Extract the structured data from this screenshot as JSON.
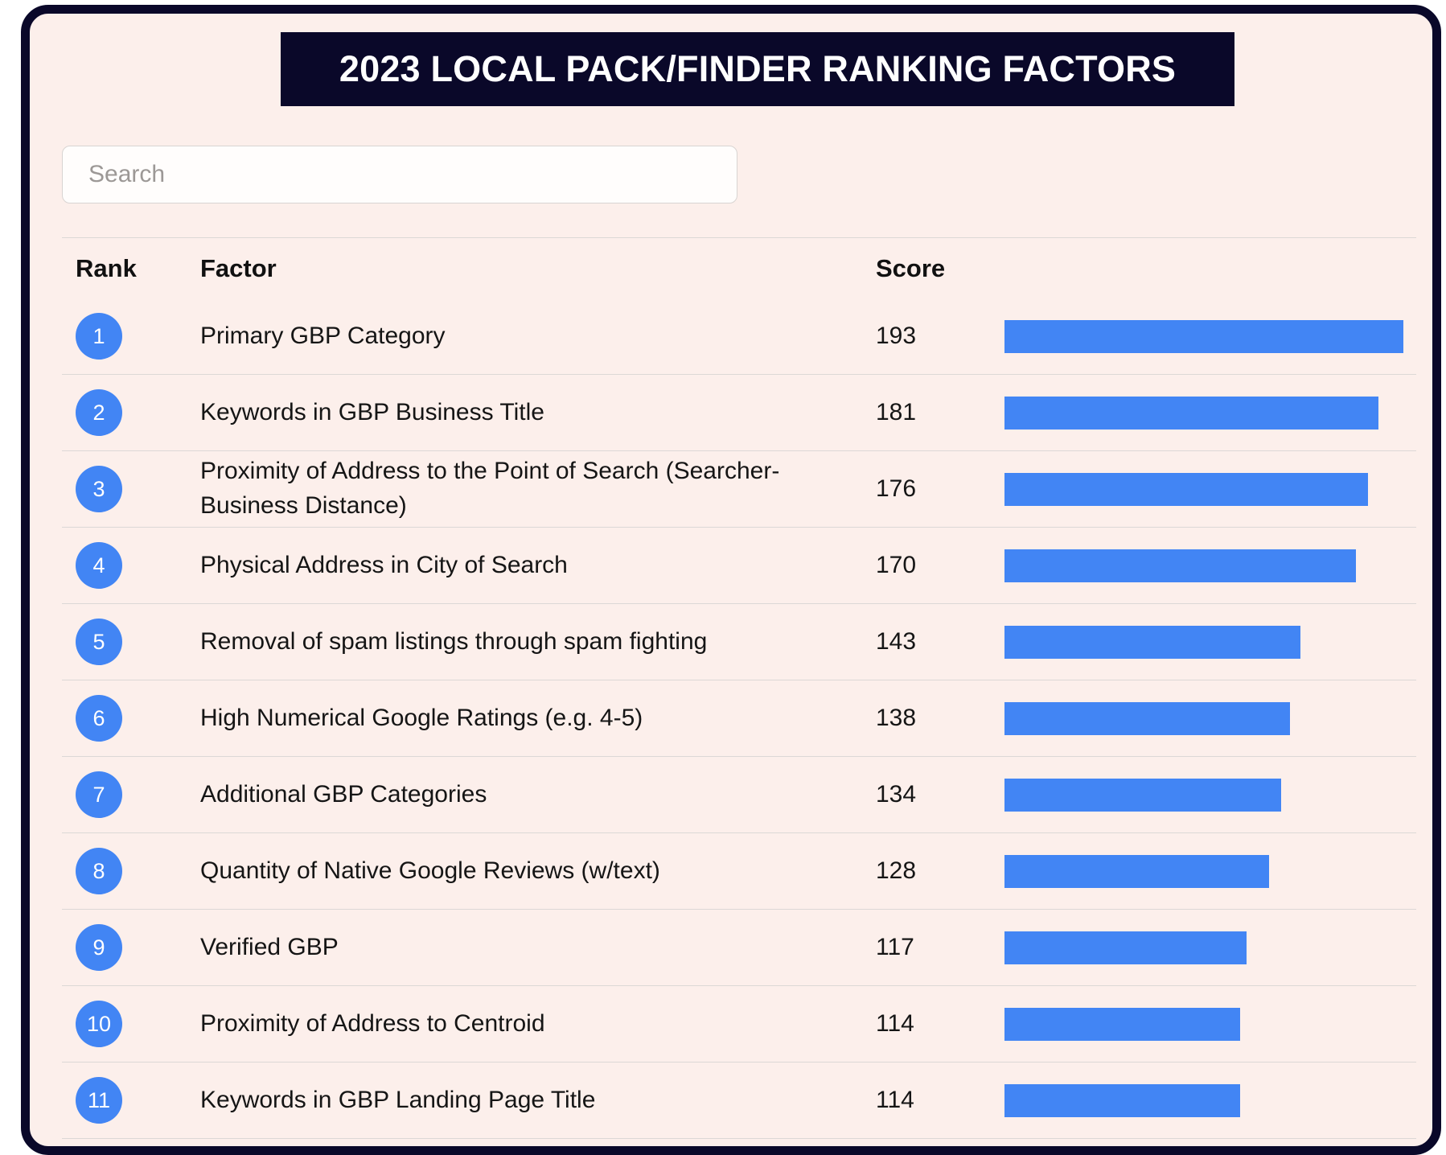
{
  "header": {
    "title": "2023 LOCAL PACK/FINDER RANKING FACTORS"
  },
  "search": {
    "placeholder": "Search",
    "value": ""
  },
  "table": {
    "columns": [
      "Rank",
      "Factor",
      "Score"
    ],
    "rows": [
      {
        "rank": "1",
        "factor": "Primary GBP Category",
        "score": "193"
      },
      {
        "rank": "2",
        "factor": "Keywords in GBP Business Title",
        "score": "181"
      },
      {
        "rank": "3",
        "factor": "Proximity of Address to the Point of Search (Searcher-Business Distance)",
        "score": "176"
      },
      {
        "rank": "4",
        "factor": "Physical Address in City of Search",
        "score": "170"
      },
      {
        "rank": "5",
        "factor": "Removal of spam listings through spam fighting",
        "score": "143"
      },
      {
        "rank": "6",
        "factor": "High Numerical Google Ratings (e.g. 4-5)",
        "score": "138"
      },
      {
        "rank": "7",
        "factor": "Additional GBP Categories",
        "score": "134"
      },
      {
        "rank": "8",
        "factor": "Quantity of Native Google Reviews (w/text)",
        "score": "128"
      },
      {
        "rank": "9",
        "factor": "Verified GBP",
        "score": "117"
      },
      {
        "rank": "10",
        "factor": "Proximity of Address to Centroid",
        "score": "114"
      },
      {
        "rank": "11",
        "factor": "Keywords in GBP Landing Page Title",
        "score": "114"
      }
    ]
  },
  "colors": {
    "accent": "#4285f4",
    "banner": "#0a0829",
    "background": "#fcefeb",
    "rule": "#dcd8d6"
  },
  "chart_data": {
    "type": "bar",
    "title": "2023 LOCAL PACK/FINDER RANKING FACTORS",
    "xlabel": "Score",
    "ylabel": "Factor",
    "orientation": "horizontal",
    "grid": false,
    "legend": null,
    "xlim": [
      0,
      193
    ],
    "categories": [
      "Primary GBP Category",
      "Keywords in GBP Business Title",
      "Proximity of Address to the Point of Search (Searcher-Business Distance)",
      "Physical Address in City of Search",
      "Removal of spam listings through spam fighting",
      "High Numerical Google Ratings (e.g. 4-5)",
      "Additional GBP Categories",
      "Quantity of Native Google Reviews (w/text)",
      "Verified GBP",
      "Proximity of Address to Centroid",
      "Keywords in GBP Landing Page Title"
    ],
    "values": [
      193,
      181,
      176,
      170,
      143,
      138,
      134,
      128,
      117,
      114,
      114
    ],
    "ranks": [
      1,
      2,
      3,
      4,
      5,
      6,
      7,
      8,
      9,
      10,
      11
    ],
    "bar_color": "#4285f4",
    "max_value": 193
  }
}
